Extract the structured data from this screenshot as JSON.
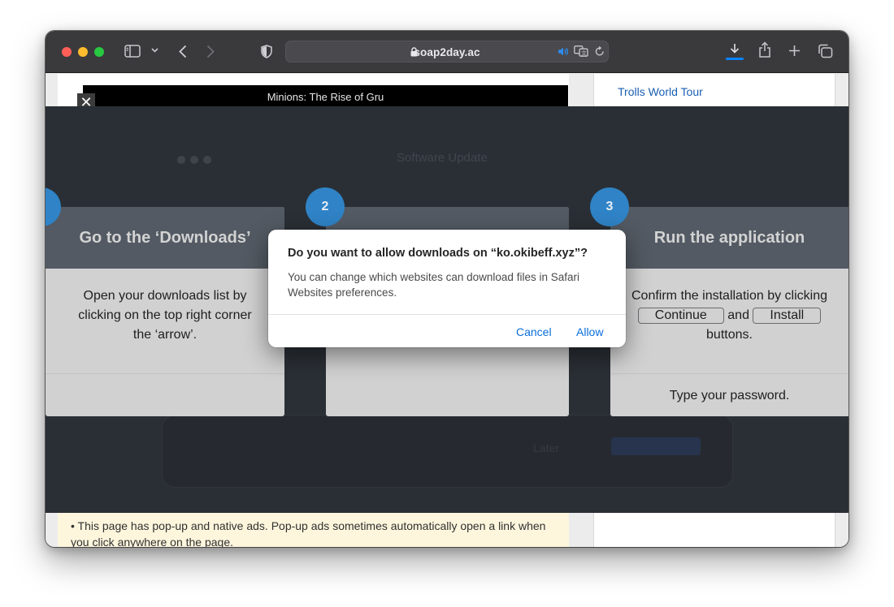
{
  "browser": {
    "address_host": "soap2day.ac",
    "icons": [
      "sidebar-icon",
      "chevron-down-icon",
      "back-icon",
      "forward-icon",
      "privacy-shield-icon",
      "lock-icon",
      "speaker-icon",
      "translate-icon",
      "reload-icon",
      "download-icon",
      "share-icon",
      "plus-icon",
      "tabs-icon"
    ],
    "accent_color": "#0a84ff"
  },
  "page": {
    "video_title": "Minions: The Rise of Gru",
    "sidebar_link": "Trolls World Tour",
    "notice": "•  This page has pop-up and native ads. Pop-up ads sometimes automatically open a link when you click anywhere on the page."
  },
  "overlay": {
    "background_label": "Software Update",
    "steps": [
      {
        "number": "",
        "title": "Go to the ‘Downloads’",
        "lines": [
          "Open your downloads list by",
          "clicking on the top right corner",
          "the ‘arrow’."
        ]
      },
      {
        "number": "2",
        "title": "",
        "lines": []
      },
      {
        "number": "3",
        "title": "Run the application",
        "line1": "Confirm the installation by clicking",
        "continue_btn": "Continue",
        "and_word": "and",
        "install_btn": "Install",
        "line3": "buttons.",
        "footer": "Type your password."
      }
    ]
  },
  "dialog": {
    "title": "Do you want to allow downloads on “ko.okibeff.xyz”?",
    "message": "You can change which websites can download files in Safari Websites preferences.",
    "cancel": "Cancel",
    "allow": "Allow",
    "button_color": "#0a6edb"
  }
}
